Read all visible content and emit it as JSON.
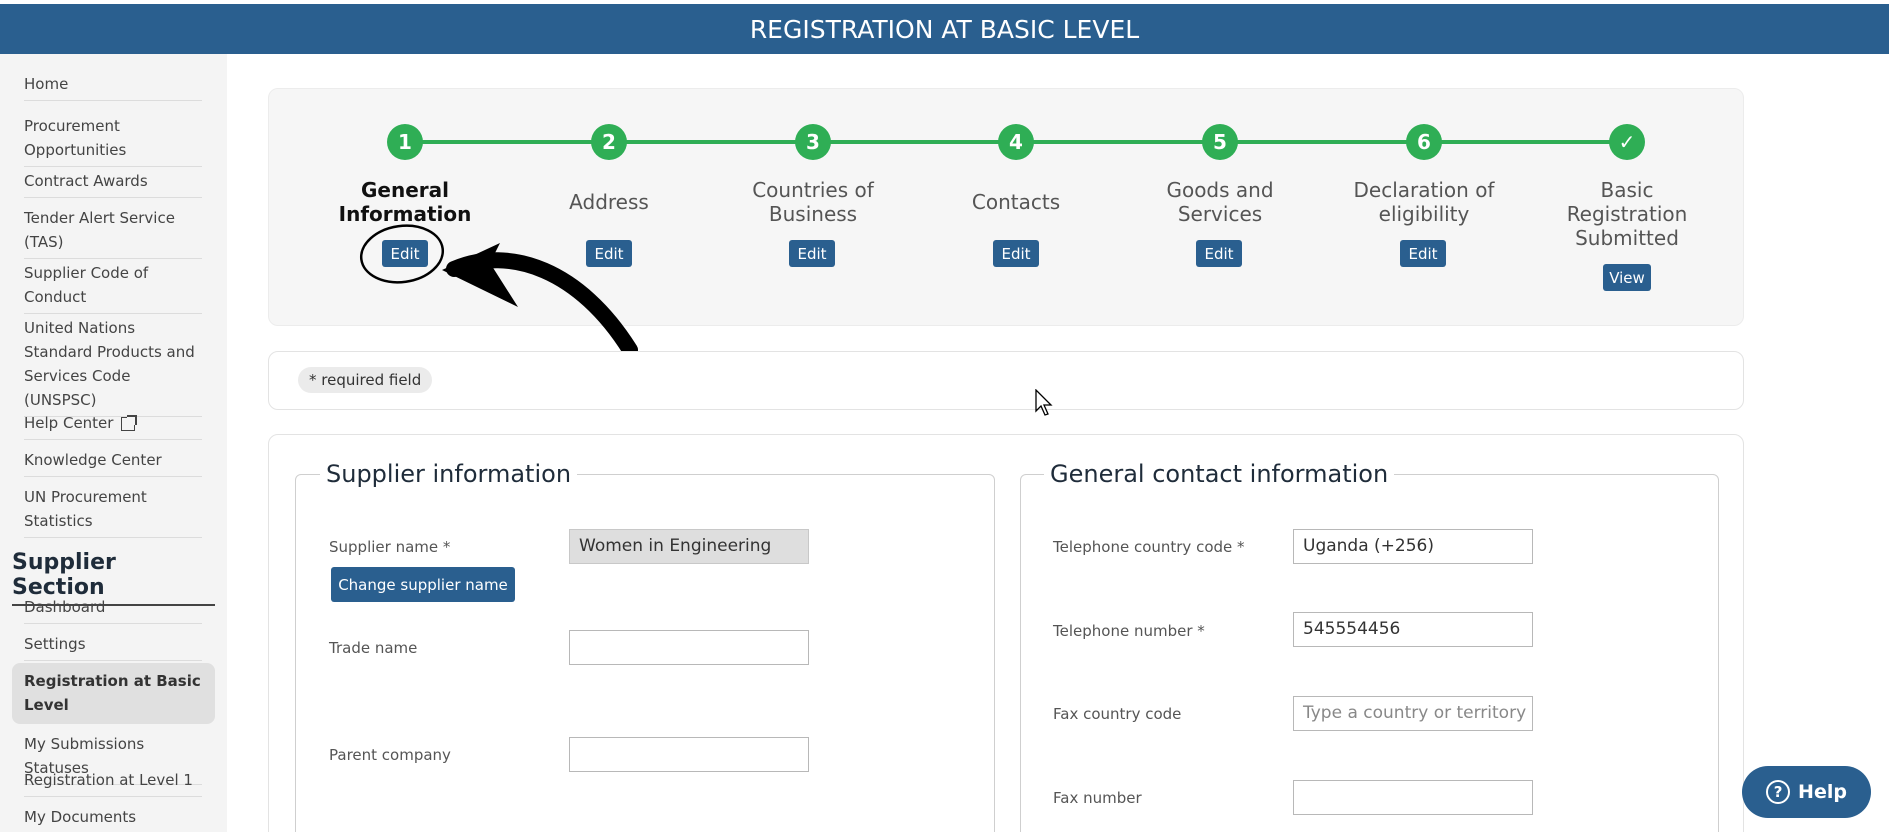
{
  "header": {
    "title": "REGISTRATION AT BASIC LEVEL"
  },
  "sidebar": {
    "links": [
      "Home",
      "Procurement Opportunities",
      "Contract Awards",
      "Tender Alert Service (TAS)",
      "Supplier Code of Conduct",
      "United Nations Standard Products and Services Code (UNSPSC)",
      "Help Center",
      "Knowledge Center",
      "UN Procurement Statistics"
    ],
    "section_title": "Supplier Section",
    "section_links": [
      "Dashboard",
      "Settings",
      "Registration at Basic Level",
      "My Submissions Statuses",
      "Registration at Level 1",
      "My Documents"
    ]
  },
  "steps": [
    {
      "number": "1",
      "label": "General Information",
      "button": "Edit",
      "current": true
    },
    {
      "number": "2",
      "label": "Address",
      "button": "Edit"
    },
    {
      "number": "3",
      "label": "Countries of Business",
      "button": "Edit"
    },
    {
      "number": "4",
      "label": "Contacts",
      "button": "Edit"
    },
    {
      "number": "5",
      "label": "Goods and Services",
      "button": "Edit"
    },
    {
      "number": "6",
      "label": "Declaration of eligibility",
      "button": "Edit"
    },
    {
      "number": "✓",
      "label": "Basic Registration Submitted",
      "button": "View"
    }
  ],
  "required_note": "* required field",
  "supplier_info": {
    "legend": "Supplier information",
    "supplier_name_label": "Supplier name *",
    "supplier_name_value": "Women in Engineering",
    "change_button": "Change supplier name",
    "trade_name_label": "Trade name",
    "trade_name_value": "",
    "parent_company_label": "Parent company",
    "parent_company_value": ""
  },
  "contact_info": {
    "legend": "General contact information",
    "tel_code_label": "Telephone country code *",
    "tel_code_value": "Uganda (+256)",
    "tel_number_label": "Telephone number *",
    "tel_number_value": "545554456",
    "fax_code_label": "Fax country code",
    "fax_code_placeholder": "Type a country or territory name",
    "fax_number_label": "Fax number",
    "fax_number_value": ""
  },
  "help_button": "Help",
  "colors": {
    "brand": "#2a5f8f",
    "step_green": "#2fae55"
  }
}
